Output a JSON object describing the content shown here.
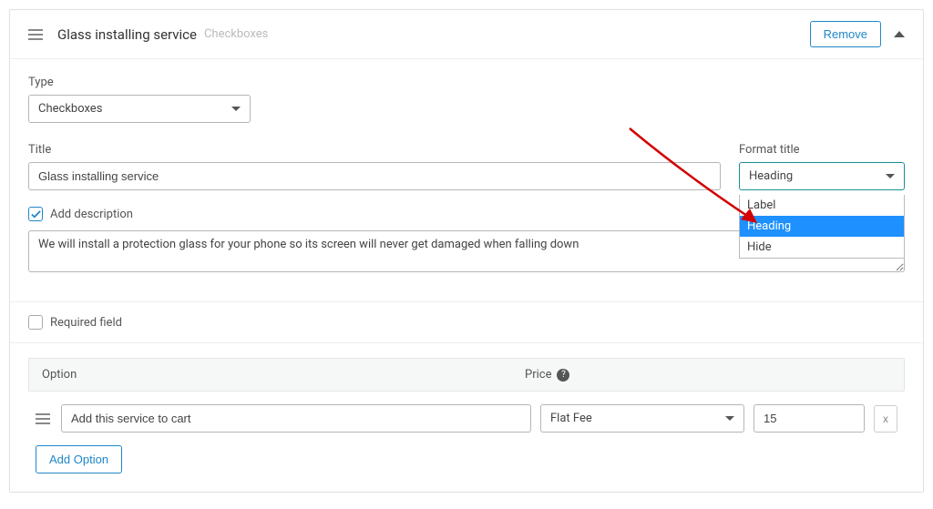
{
  "header": {
    "title": "Glass installing service",
    "subtitle": "Checkboxes",
    "remove_label": "Remove"
  },
  "type": {
    "label": "Type",
    "value": "Checkboxes"
  },
  "title_field": {
    "label": "Title",
    "value": "Glass installing service"
  },
  "format_title": {
    "label": "Format title",
    "value": "Heading",
    "options": [
      "Label",
      "Heading",
      "Hide"
    ],
    "selected_index": 1
  },
  "add_description": {
    "label": "Add description",
    "checked": true,
    "value": "We will install a protection glass for your phone so its screen will never get damaged when falling down"
  },
  "required": {
    "label": "Required field",
    "checked": false
  },
  "options": {
    "header_option": "Option",
    "header_price": "Price",
    "rows": [
      {
        "name": "Add this service to cart",
        "price_type": "Flat Fee",
        "price_value": "15"
      }
    ],
    "add_option_label": "Add Option",
    "remove_row_label": "x"
  }
}
